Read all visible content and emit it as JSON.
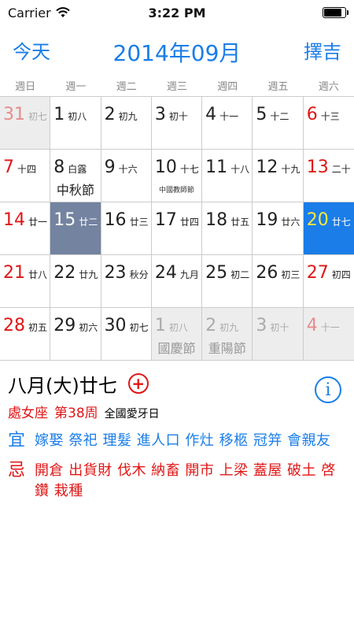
{
  "status": {
    "carrier": "Carrier",
    "time": "3:22 PM",
    "battery_level": 0.92
  },
  "nav": {
    "today": "今天",
    "title": "2014年09月",
    "select": "擇吉"
  },
  "weekdays": [
    "週日",
    "週一",
    "週二",
    "週三",
    "週四",
    "週五",
    "週六"
  ],
  "days": [
    {
      "d": "31",
      "l": "初七",
      "state": "other",
      "num": "red-gray"
    },
    {
      "d": "1",
      "l": "初八"
    },
    {
      "d": "2",
      "l": "初九"
    },
    {
      "d": "3",
      "l": "初十"
    },
    {
      "d": "4",
      "l": "十一"
    },
    {
      "d": "5",
      "l": "十二"
    },
    {
      "d": "6",
      "l": "十三",
      "num": "red"
    },
    {
      "d": "7",
      "l": "十四",
      "num": "red"
    },
    {
      "d": "8",
      "l": "白露",
      "sub": "中秋節",
      "subsize": "big"
    },
    {
      "d": "9",
      "l": "十六"
    },
    {
      "d": "10",
      "l": "十七",
      "sub": "中國教師節",
      "subsize": "small"
    },
    {
      "d": "11",
      "l": "十八"
    },
    {
      "d": "12",
      "l": "十九"
    },
    {
      "d": "13",
      "l": "二十",
      "num": "red"
    },
    {
      "d": "14",
      "l": "廿一",
      "num": "red"
    },
    {
      "d": "15",
      "l": "廿二",
      "state": "selected"
    },
    {
      "d": "16",
      "l": "廿三"
    },
    {
      "d": "17",
      "l": "廿四"
    },
    {
      "d": "18",
      "l": "廿五"
    },
    {
      "d": "19",
      "l": "廿六"
    },
    {
      "d": "20",
      "l": "廿七",
      "state": "today"
    },
    {
      "d": "21",
      "l": "廿八",
      "num": "red"
    },
    {
      "d": "22",
      "l": "廿九"
    },
    {
      "d": "23",
      "l": "秋分"
    },
    {
      "d": "24",
      "l": "九月"
    },
    {
      "d": "25",
      "l": "初二"
    },
    {
      "d": "26",
      "l": "初三"
    },
    {
      "d": "27",
      "l": "初四",
      "num": "red"
    },
    {
      "d": "28",
      "l": "初五",
      "num": "red"
    },
    {
      "d": "29",
      "l": "初六"
    },
    {
      "d": "30",
      "l": "初七"
    },
    {
      "d": "1",
      "l": "初八",
      "state": "other",
      "sub": "國慶節",
      "subsize": "big"
    },
    {
      "d": "2",
      "l": "初九",
      "state": "other",
      "sub": "重陽節",
      "subsize": "big"
    },
    {
      "d": "3",
      "l": "初十",
      "state": "other"
    },
    {
      "d": "4",
      "l": "十一",
      "state": "other",
      "num": "red-gray"
    }
  ],
  "info": {
    "lunar_date": "八月(大)廿七",
    "zodiac": "處女座",
    "week": "第38周",
    "holiday": "全國愛牙日",
    "yi_label": "宜",
    "yi_text": "嫁娶 祭祀 理髮 進人口 作灶 移柩 冠笄 會親友",
    "ji_label": "忌",
    "ji_text": "開倉 出貨財 伐木 納畜 開市 上梁 蓋屋 破土 啓鑽 栽種"
  },
  "colors": {
    "accent": "#1a7de8",
    "red": "#e01616",
    "selected": "#7383a0"
  }
}
